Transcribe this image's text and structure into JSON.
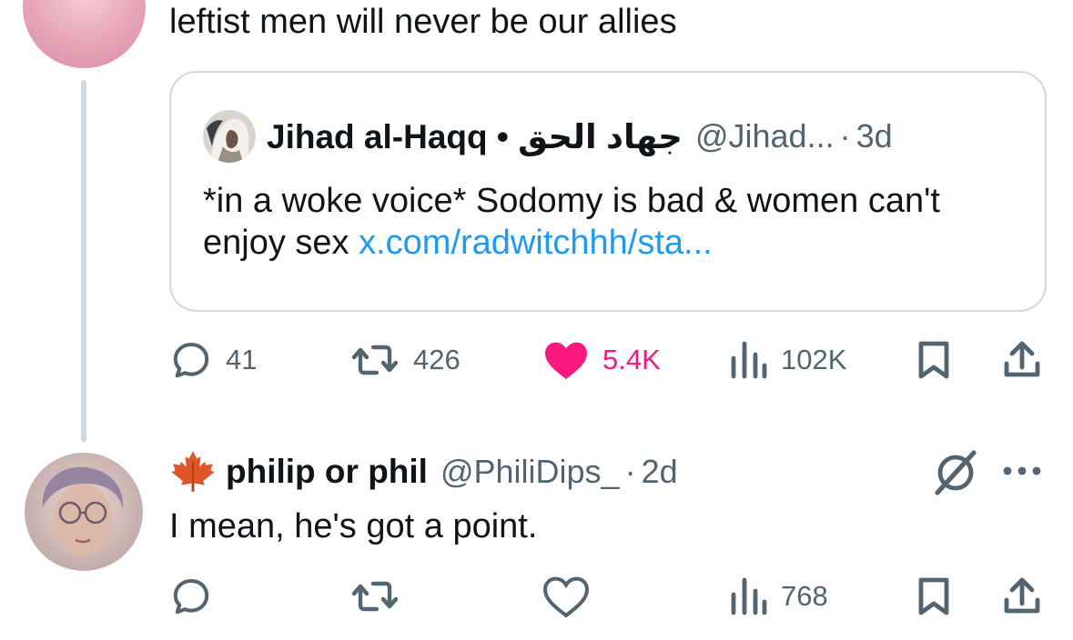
{
  "tweet_top": {
    "text": "leftist men will never be our allies",
    "quote": {
      "name": "Jihad al-Haqq • جهاد الحق",
      "handle": "@Jihad...",
      "separator": "·",
      "time": "3d",
      "body_text": "*in a woke voice* Sodomy is bad & women can't enjoy sex",
      "link_text": "x.com/radwitchhh/sta..."
    },
    "actions": {
      "replies": "41",
      "reposts": "426",
      "likes": "5.4K",
      "views": "102K",
      "liked": true,
      "like_color": "#f91880"
    }
  },
  "tweet_reply": {
    "emoji_icon": "maple-leaf-icon",
    "name": "philip or phil",
    "handle": "@PhiliDips_",
    "separator": "·",
    "time": "2d",
    "text": "I mean, he's got a point.",
    "actions": {
      "views": "768"
    }
  },
  "colors": {
    "text_primary": "#0f1419",
    "text_secondary": "#536471",
    "link": "#1d9bf0",
    "border": "#cfd9de"
  },
  "icons": [
    "reply-icon",
    "repost-icon",
    "like-icon",
    "views-icon",
    "bookmark-icon",
    "share-icon",
    "grok-icon",
    "more-icon"
  ]
}
